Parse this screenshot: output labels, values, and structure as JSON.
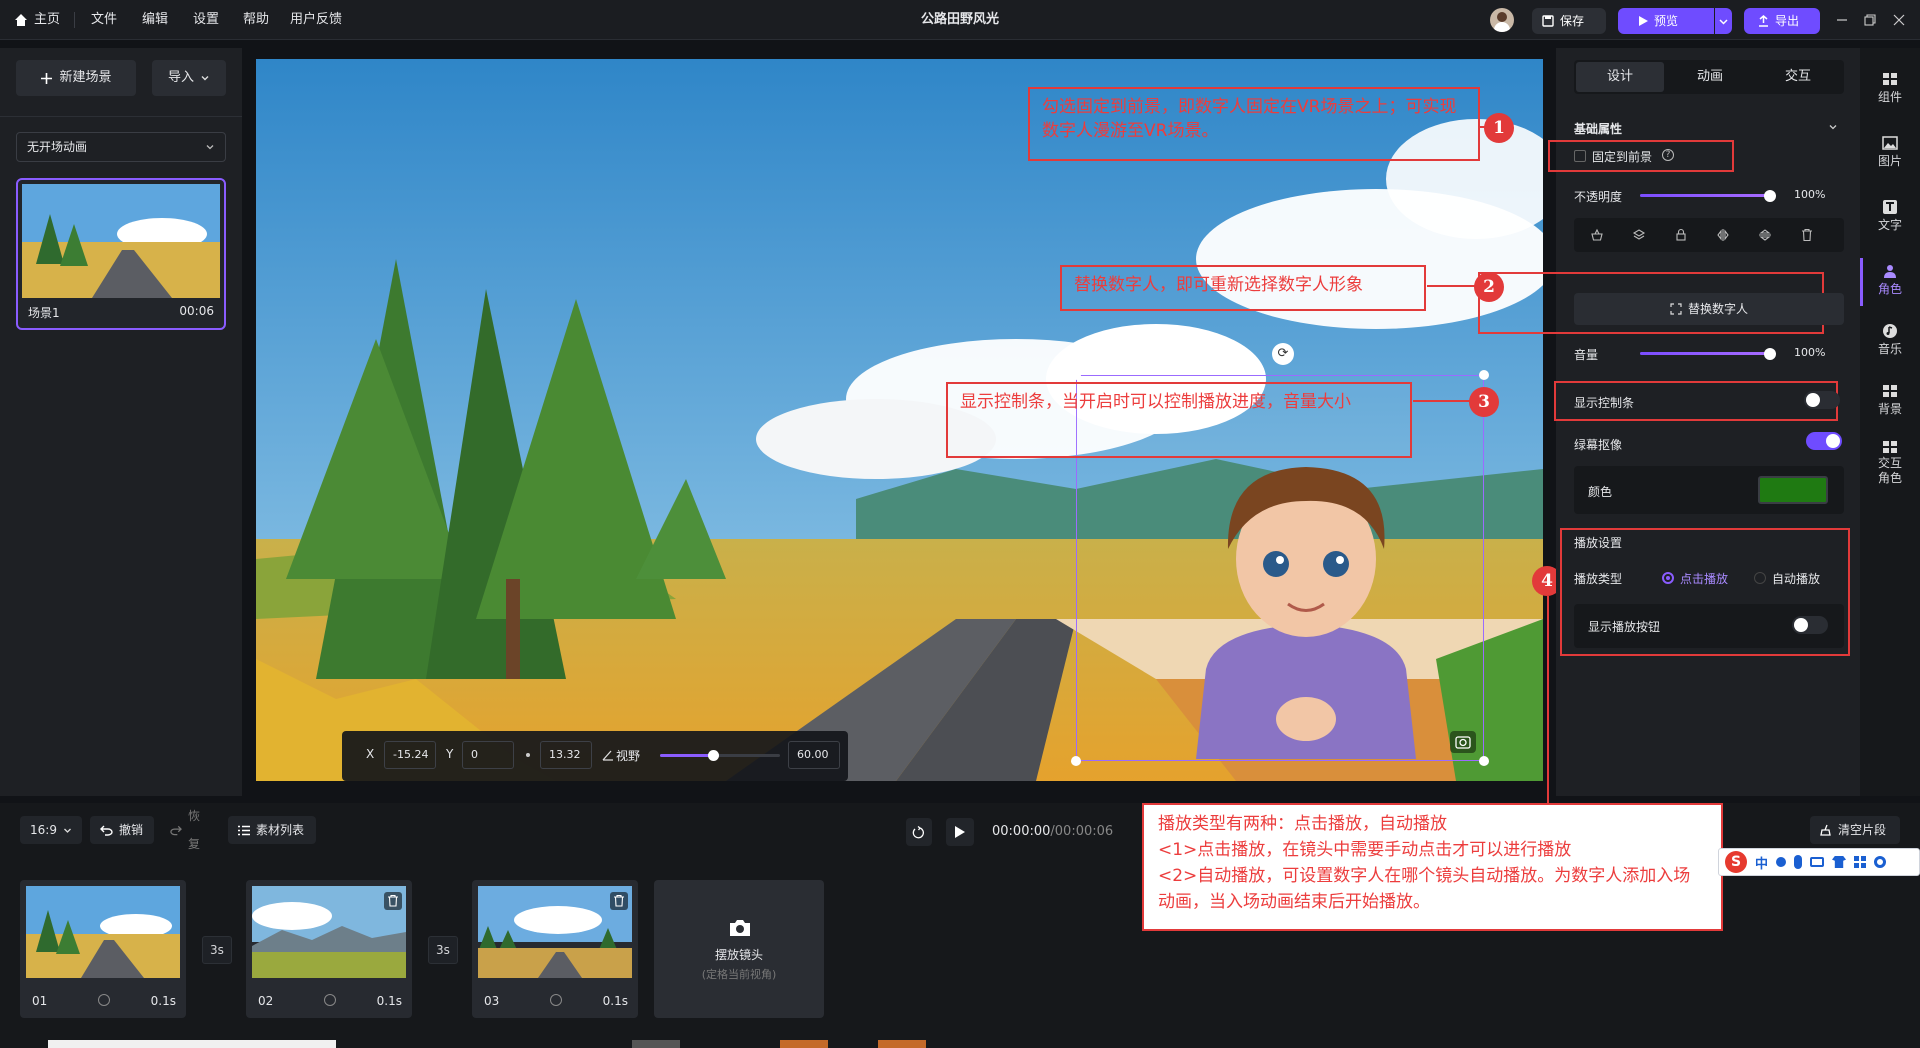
{
  "topbar": {
    "home": "主页",
    "menus": [
      "文件",
      "编辑",
      "设置",
      "帮助",
      "用户反馈"
    ],
    "title": "公路田野风光",
    "save": "保存",
    "preview": "预览",
    "export": "导出"
  },
  "left": {
    "new_scene": "新建场景",
    "import": "导入",
    "entry_anim": "无开场动画",
    "scene_name": "场景1",
    "scene_duration": "00:06"
  },
  "preview": {
    "x_label": "X",
    "x_value": "-15.24",
    "y_label": "Y",
    "y_value": "0",
    "z_value": "13.32",
    "fov_label": "视野",
    "fov_value": "60.00",
    "fov_level": 0.45
  },
  "annotations": {
    "a1": "勾选固定到前景，即数字人固定在VR场景之上；可实现数字人漫游至VR场景。",
    "a2": "替换数字人，即可重新选择数字人形象",
    "a3": "显示控制条，当开启时可以控制播放进度，音量大小",
    "a4_lines": [
      "播放类型有两种：点击播放，自动播放",
      "<1>点击播放，在镜头中需要手动点击才可以进行播放",
      "<2>自动播放，可设置数字人在哪个镜头自动播放。为数字人添加入场动画，当入场动画结束后开始播放。"
    ],
    "n1": "1",
    "n2": "2",
    "n3": "3",
    "n4": "4"
  },
  "right": {
    "tabs": [
      "设计",
      "动画",
      "交互"
    ],
    "section_basic": "基础属性",
    "pin_foreground": "固定到前景",
    "opacity_label": "不透明度",
    "opacity_value": "100%",
    "opacity_level": 1.0,
    "replace_avatar": "替换数字人",
    "volume_label": "音量",
    "volume_value": "100%",
    "volume_level": 1.0,
    "show_controls": "显示控制条",
    "show_controls_on": false,
    "chroma_key": "绿幕抠像",
    "chroma_key_on": true,
    "color_label": "颜色",
    "color_value": "#1f7a12",
    "play_settings": "播放设置",
    "play_type_label": "播放类型",
    "play_click": "点击播放",
    "play_auto": "自动播放",
    "show_play_btn": "显示播放按钮",
    "show_play_btn_on": false
  },
  "rail": [
    {
      "icon": "component-icon",
      "label": "组件"
    },
    {
      "icon": "image-icon",
      "label": "图片"
    },
    {
      "icon": "text-icon",
      "label": "文字"
    },
    {
      "icon": "character-icon",
      "label": "角色"
    },
    {
      "icon": "music-icon",
      "label": "音乐"
    },
    {
      "icon": "background-icon",
      "label": "背景"
    },
    {
      "icon": "interactive-character-icon",
      "label": "交互角色"
    }
  ],
  "bottom": {
    "ratio": "16:9",
    "undo": "撤销",
    "redo": "恢复",
    "assets": "素材列表",
    "time_current": "00:00:00",
    "time_total": "/00:00:06",
    "clear": "清空片段",
    "shots": [
      {
        "id": "01",
        "dur": "0.1s"
      },
      {
        "id": "02",
        "dur": "0.1s"
      },
      {
        "id": "03",
        "dur": "0.1s"
      }
    ],
    "gaps": [
      "3s",
      "3s"
    ],
    "place_camera": "摆放镜头",
    "place_camera_sub": "(定格当前视角)"
  },
  "ime": "中",
  "colors": {
    "accent": "#6f4cff",
    "annotation": "#e23a3a"
  }
}
